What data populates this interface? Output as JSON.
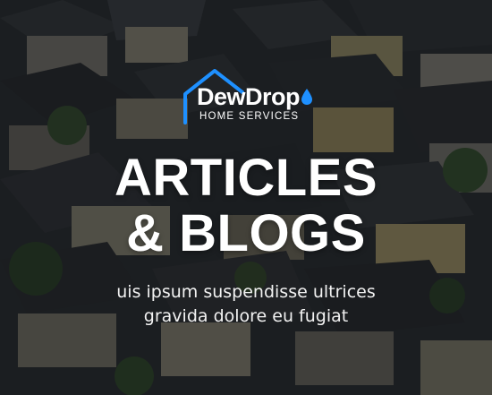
{
  "colors": {
    "logo_accent": "#1e90ff",
    "text": "#ffffff",
    "overlay": "#0c0e11"
  },
  "background": {
    "description_icon": "suburban-houses-aerial-photo"
  },
  "logo": {
    "icon": "house-outline-icon",
    "brand_part1": "Dew",
    "brand_part2": "Drop",
    "tagline": "HOME SERVICES"
  },
  "hero": {
    "title_line1": "ARTICLES",
    "title_line2": "& BLOGS",
    "subtitle_line1": "uis ipsum suspendisse ultrices",
    "subtitle_line2": "gravida dolore eu fugiat"
  }
}
